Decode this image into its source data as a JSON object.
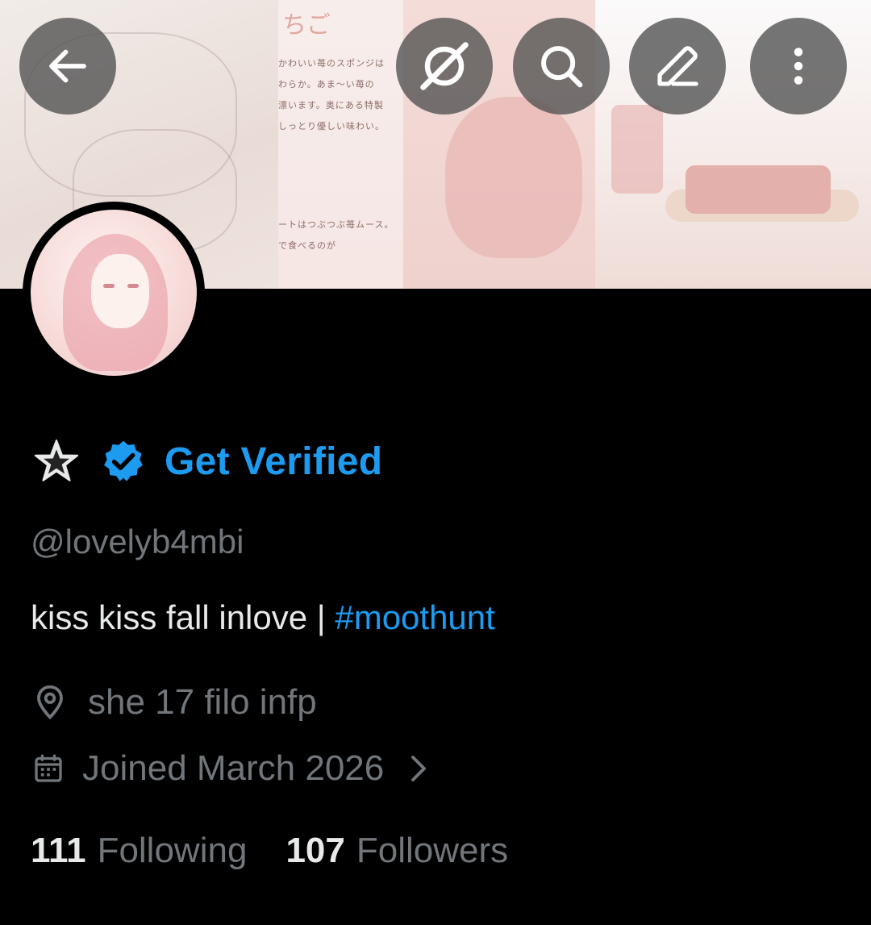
{
  "colors": {
    "accent": "#1d9bf0",
    "text_primary": "#e7e9ea",
    "text_secondary": "#71767b",
    "background": "#000000",
    "icon_button_bg": "#505050"
  },
  "header": {
    "back_icon": "arrow-left-icon",
    "grok_icon": "grok-icon",
    "search_icon": "search-icon",
    "edit_icon": "pencil-icon",
    "more_icon": "more-vertical-icon"
  },
  "profile": {
    "verify_cta": "Get Verified",
    "handle": "@lovelyb4mbi",
    "bio_text": "kiss kiss fall inlove | ",
    "bio_hashtag": "#moothunt",
    "location": "she 17 filo infp",
    "joined": "Joined March 2026",
    "following_count": "111",
    "following_label": "Following",
    "followers_count": "107",
    "followers_label": "Followers"
  }
}
